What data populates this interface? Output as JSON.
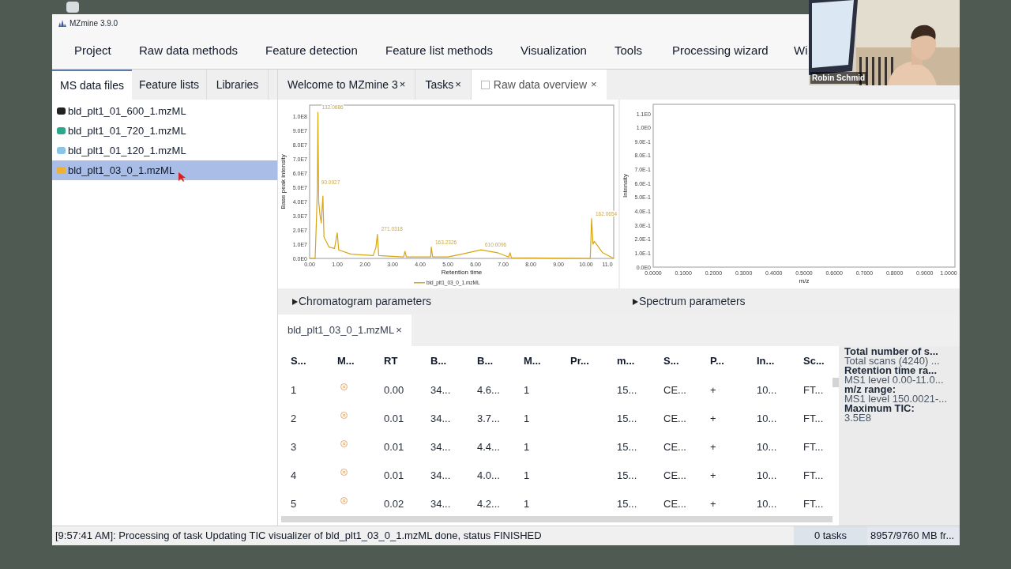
{
  "window": {
    "title": "MZmine 3.9.0"
  },
  "menu": [
    "Project",
    "Raw data methods",
    "Feature detection",
    "Feature list methods",
    "Visualization",
    "Tools",
    "Processing wizard",
    "Wi"
  ],
  "left_tabs": [
    {
      "label": "MS data files",
      "selected": true
    },
    {
      "label": "Feature lists",
      "selected": false
    },
    {
      "label": "Libraries",
      "selected": false
    }
  ],
  "files": [
    {
      "name": "bld_plt1_01_600_1.mzML",
      "color": "#222222",
      "selected": false
    },
    {
      "name": "bld_plt1_01_720_1.mzML",
      "color": "#2aa889",
      "selected": false
    },
    {
      "name": "bld_plt1_01_120_1.mzML",
      "color": "#8cc4e8",
      "selected": false
    },
    {
      "name": "bld_plt1_03_0_1.mzML",
      "color": "#f0b030",
      "selected": true
    }
  ],
  "main_tabs": [
    {
      "label": "Welcome to MZmine 3",
      "close": "×",
      "kind": "plain",
      "selected": false
    },
    {
      "label": "Tasks",
      "close": "×",
      "kind": "plain",
      "selected": false
    },
    {
      "label": "Raw data overview",
      "close": "×",
      "kind": "checkbox",
      "selected": true
    }
  ],
  "chromatogram": {
    "chart_data": {
      "type": "line",
      "ylabel": "Base peak intensity",
      "xlabel": "Retention time",
      "x": [
        0,
        0.2,
        0.25,
        0.28,
        0.3,
        0.33,
        0.38,
        0.42,
        0.48,
        0.52,
        0.7,
        0.9,
        1,
        1.05,
        1.5,
        2.3,
        2.4,
        2.45,
        2.5,
        3.4,
        3.45,
        3.5,
        4.38,
        4.4,
        4.45,
        5,
        5.5,
        6.2,
        6.8,
        7.2,
        7.25,
        7.3,
        10.15,
        10.2,
        10.25,
        10.3,
        10.6,
        11
      ],
      "series": [
        {
          "name": "bld_plt1_03_0_1.mzML",
          "color": "#d9a514",
          "values": [
            0,
            0,
            30000000,
            50000000,
            103000000,
            40000000,
            30000000,
            25000000,
            44000000,
            15000000,
            8000000,
            7000000,
            18000000,
            6000000,
            3000000,
            2000000,
            8000000,
            17000000,
            2000000,
            1000000,
            5000000,
            1000000,
            1000000,
            8000000,
            1000000,
            1000000,
            3000000,
            6000000,
            4000000,
            1000000,
            4000000,
            500000,
            0,
            28000000,
            10000000,
            12000000,
            4000000,
            0
          ]
        }
      ],
      "xlim": [
        0,
        11
      ],
      "ylim": [
        0,
        108000000
      ],
      "yticks": [
        {
          "value": 100000000,
          "label": "1.0E8"
        },
        {
          "value": 90000000,
          "label": "9.0E7"
        },
        {
          "value": 80000000,
          "label": "8.0E7"
        },
        {
          "value": 70000000,
          "label": "7.0E7"
        },
        {
          "value": 60000000,
          "label": "6.0E7"
        },
        {
          "value": 50000000,
          "label": "5.0E7"
        },
        {
          "value": 40000000,
          "label": "4.0E7"
        },
        {
          "value": 30000000,
          "label": "3.0E7"
        },
        {
          "value": 20000000,
          "label": "2.0E7"
        },
        {
          "value": 10000000,
          "label": "1.0E7"
        },
        {
          "value": 0,
          "label": "0.0E0"
        }
      ],
      "xticks": [
        {
          "value": 0,
          "label": "0.00"
        },
        {
          "value": 1,
          "label": "1.00"
        },
        {
          "value": 2,
          "label": "2.00"
        },
        {
          "value": 3,
          "label": "3.00"
        },
        {
          "value": 4,
          "label": "4.00"
        },
        {
          "value": 5,
          "label": "5.00"
        },
        {
          "value": 6,
          "label": "6.00"
        },
        {
          "value": 7,
          "label": "7.00"
        },
        {
          "value": 8,
          "label": "8.00"
        },
        {
          "value": 9,
          "label": "9.00"
        },
        {
          "value": 10,
          "label": "10.00"
        },
        {
          "value": 11,
          "label": "11.0"
        }
      ],
      "annotations": [
        {
          "text": "132.0686",
          "x": 0.3,
          "y": 103000000
        },
        {
          "text": "90.0927",
          "x": 0.28,
          "y": 50000000
        },
        {
          "text": "271.0318",
          "x": 2.45,
          "y": 17000000
        },
        {
          "text": "163.2326",
          "x": 4.4,
          "y": 8000000
        },
        {
          "text": "610.0096",
          "x": 6.2,
          "y": 6000000
        },
        {
          "text": "162.0654",
          "x": 10.2,
          "y": 28000000
        }
      ]
    }
  },
  "spectrum": {
    "ylabel": "Intensity",
    "xlabel": "m/z",
    "yticks": [
      "1.1E0",
      "1.0E0",
      "9.0E-1",
      "8.0E-1",
      "7.0E-1",
      "6.0E-1",
      "5.0E-1",
      "4.0E-1",
      "3.0E-1",
      "2.0E-1",
      "1.0E-1",
      "0.0E0"
    ],
    "xticks": [
      "0.0000",
      "0.1000",
      "0.2000",
      "0.3000",
      "0.4000",
      "0.5000",
      "0.6000",
      "0.7000",
      "0.8000",
      "0.9000",
      "1.0000"
    ]
  },
  "parameter_sections": [
    {
      "label": "Chromatogram parameters",
      "expanded": false
    },
    {
      "label": "Spectrum parameters",
      "expanded": false
    }
  ],
  "file_tab": {
    "label": "bld_plt1_03_0_1.mzML",
    "close": "×"
  },
  "table": {
    "columns": [
      {
        "label": "S...",
        "kind": "text"
      },
      {
        "label": "M...",
        "kind": "icon"
      },
      {
        "label": "RT",
        "kind": "text"
      },
      {
        "label": "B...",
        "kind": "text"
      },
      {
        "label": "B...",
        "kind": "text"
      },
      {
        "label": "M...",
        "kind": "text"
      },
      {
        "label": "Pr...",
        "kind": "text"
      },
      {
        "label": "m...",
        "kind": "text"
      },
      {
        "label": "S...",
        "kind": "text"
      },
      {
        "label": "P...",
        "kind": "text"
      },
      {
        "label": "In...",
        "kind": "text"
      },
      {
        "label": "Sc...",
        "kind": "text"
      }
    ],
    "rows": [
      [
        "1",
        null,
        "0.00",
        "34...",
        "4.6...",
        "1",
        null,
        "15...",
        "CE...",
        "+",
        "10...",
        "FT..."
      ],
      [
        "2",
        null,
        "0.01",
        "34...",
        "3.7...",
        "1",
        null,
        "15...",
        "CE...",
        "+",
        "10...",
        "FT..."
      ],
      [
        "3",
        null,
        "0.01",
        "34...",
        "4.4...",
        "1",
        null,
        "15...",
        "CE...",
        "+",
        "10...",
        "FT..."
      ],
      [
        "4",
        null,
        "0.01",
        "34...",
        "4.0...",
        "1",
        null,
        "15...",
        "CE...",
        "+",
        "10...",
        "FT..."
      ],
      [
        "5",
        null,
        "0.02",
        "34...",
        "4.2...",
        "1",
        null,
        "15...",
        "CE...",
        "+",
        "10...",
        "FT..."
      ]
    ]
  },
  "info": [
    {
      "text": "Total number of s...",
      "kind": "heading"
    },
    {
      "text": "Total scans (4240) ...",
      "kind": "value"
    },
    {
      "text": "Retention time ra...",
      "kind": "heading"
    },
    {
      "text": "MS1 level 0.00-11.0...",
      "kind": "value"
    },
    {
      "text": "m/z range:",
      "kind": "heading"
    },
    {
      "text": "MS1 level 150.0021-...",
      "kind": "value"
    },
    {
      "text": "Maximum TIC:",
      "kind": "heading"
    },
    {
      "text": "3.5E8",
      "kind": "value"
    }
  ],
  "status_bar": {
    "message": "[9:57:41 AM]: Processing of task Updating TIC visualizer of bld_plt1_03_0_1.mzML done, status FINISHED",
    "tasks": "0 tasks",
    "memory": "8957/9760 MB fr..."
  },
  "video": {
    "name": "Robin Schmid"
  }
}
